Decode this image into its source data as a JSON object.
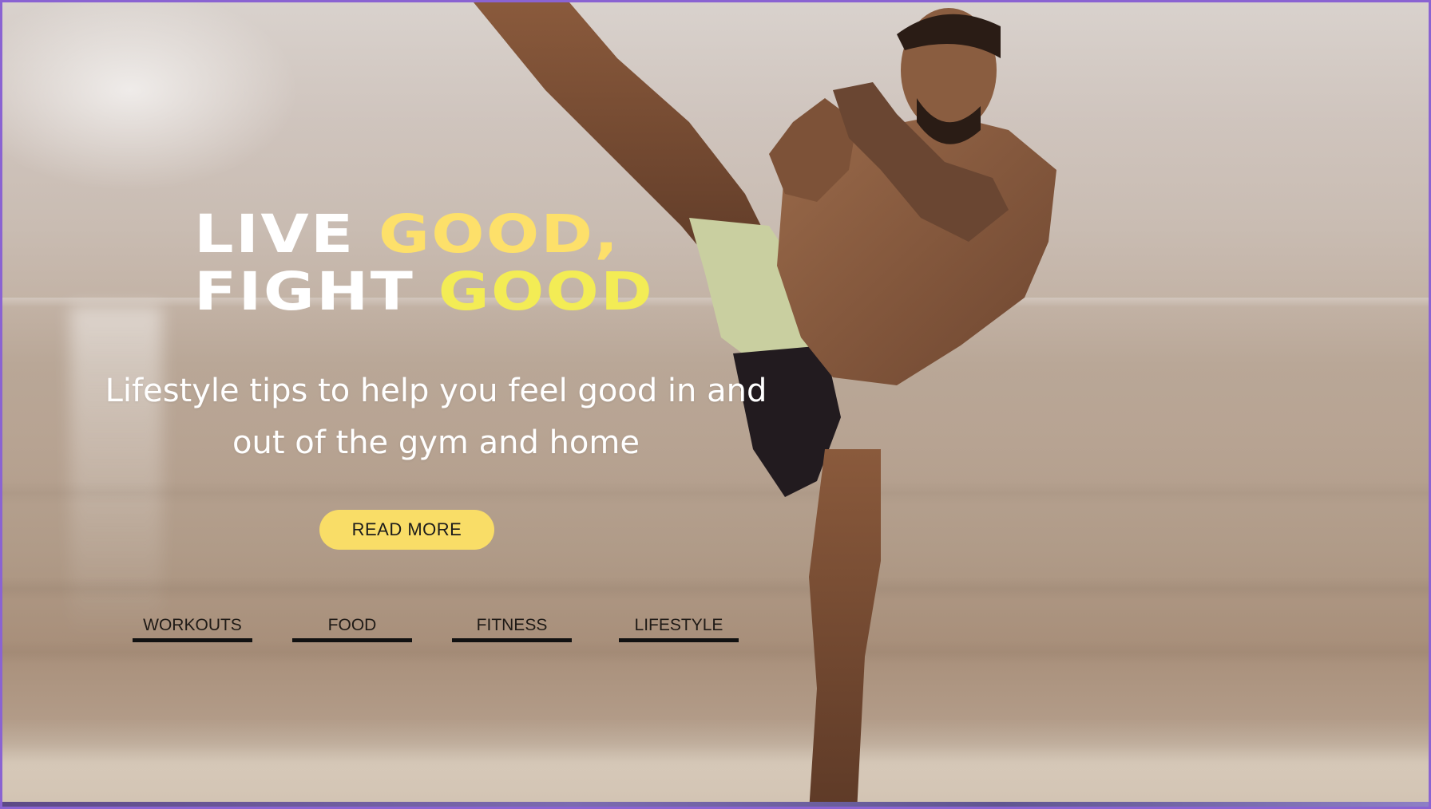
{
  "hero": {
    "headline": {
      "line1_white": "LIVE ",
      "line1_accent": "GOOD,",
      "line2_white": "FIGHT ",
      "line2_accent": "GOOD"
    },
    "subtitle": "Lifestyle tips to help you feel good in and out of the gym and home",
    "cta_label": "READ MORE"
  },
  "categories": [
    {
      "label": "WORKOUTS"
    },
    {
      "label": "FOOD"
    },
    {
      "label": "FITNESS"
    },
    {
      "label": "LIFESTYLE"
    }
  ],
  "colors": {
    "accent_yellow": "#fde06a",
    "accent_yellow_bright": "#f3ec55",
    "button_bg": "#f9dd67",
    "frame_border": "#8a63d2"
  },
  "icons": {
    "hero_image": "kickboxer-beach-photo"
  }
}
